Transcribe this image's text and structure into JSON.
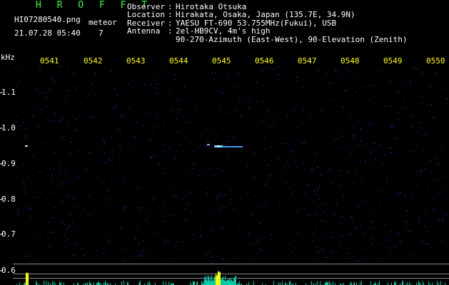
{
  "header": {
    "brand": "H R O F F T",
    "filename": "HI07280540.png",
    "meteor_label": "meteor",
    "timestamp": "21.07.28 05:40",
    "meteor_count": "7"
  },
  "info": [
    {
      "key": "Observer",
      "value": "Hirotaka Otsuka"
    },
    {
      "key": "Location",
      "value": "Hirakata, Osaka, Japan (135.7E, 34.9N)"
    },
    {
      "key": "Receiver",
      "value": "YAESU FT-690 53.755MHz(Fukui), USB"
    },
    {
      "key": "Antenna",
      "value": "2el-HB9CV, 4m's high"
    },
    {
      "key": "",
      "value": "90-270-Azimuth (East-West), 90-Elevation (Zenith)"
    }
  ],
  "axis": {
    "y_unit": "kHz",
    "x_ticks": [
      "0541",
      "0542",
      "0543",
      "0544",
      "0545",
      "0546",
      "0547",
      "0548",
      "0549",
      "0550"
    ],
    "y_ticks": [
      "1.1",
      "1.0",
      "0.9",
      "0.8",
      "0.7",
      "0.6"
    ]
  },
  "colors": {
    "brand": "#33ff33",
    "tick_x": "#ffff00",
    "tick_y": "#ffffff",
    "echo": "#66ccff",
    "histogram": "#00ccaa",
    "histogram_peak": "#ffff00"
  }
}
